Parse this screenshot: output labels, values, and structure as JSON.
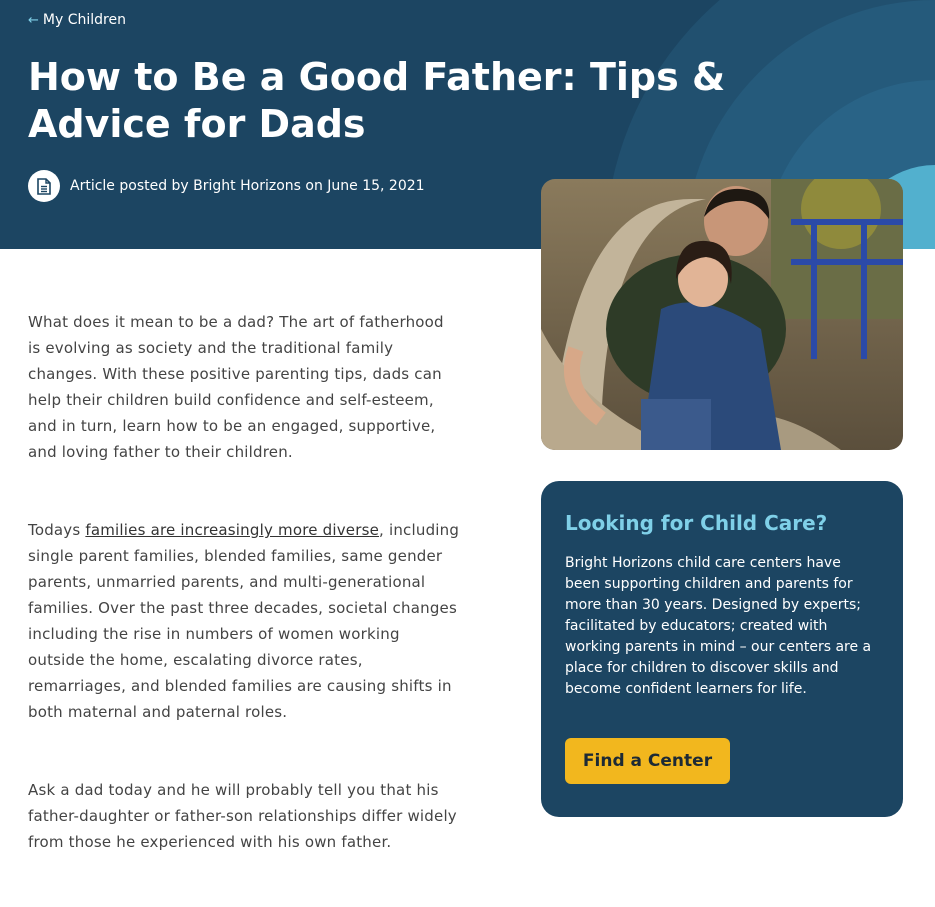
{
  "breadcrumb": {
    "arrow": "←",
    "label": "My Children"
  },
  "article": {
    "title": "How to Be a Good Father: Tips & Advice for Dads",
    "byline_icon": "document-icon",
    "byline": "Article posted by Bright Horizons on June 15, 2021",
    "paragraph1": "What does it mean to be a dad? The art of fatherhood is evolving as society and the traditional family changes. With these positive parenting tips, dads can help their children build confidence and self-esteem, and in turn, learn how to be an engaged, supportive, and loving father to their children.",
    "paragraph2_intro": "Todays ",
    "paragraph2_link": "families are increasingly more diverse",
    "paragraph2_rest": ", including single parent families, blended families, same gender parents, unmarried parents, and multi-generational families. Over the past three decades, societal changes including the rise in numbers of women working outside the home, escalating divorce rates, remarriages, and blended families are causing shifts in both maternal and paternal roles.",
    "paragraph3": "Ask a dad today and he will probably tell you that his father-daughter or father-son relationships differ widely from those he experienced with his own father."
  },
  "cta": {
    "title": "Looking for Child Care?",
    "body": "Bright Horizons child care centers have been supporting children and parents for more than 30 years. Designed by experts; facilitated by educators; created with working parents in mind – our centers are a place for children to discover skills and become confident learners for life.",
    "button": "Find a Center"
  },
  "colors": {
    "hero_bg": "#1c4562",
    "accent_light_blue": "#7fd0e8",
    "button_yellow": "#f2b71e",
    "body_text": "#444444"
  }
}
